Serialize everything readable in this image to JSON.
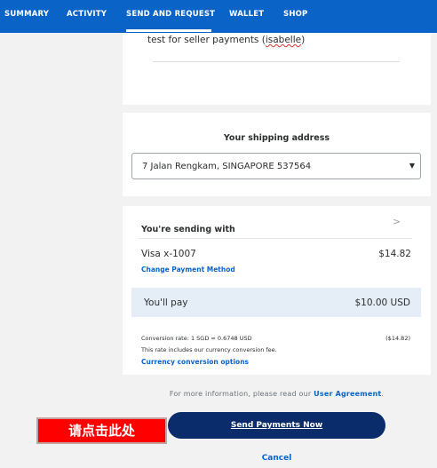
{
  "nav": {
    "items": [
      "SUMMARY",
      "ACTIVITY",
      "SEND AND REQUEST",
      "WALLET",
      "SHOP"
    ],
    "active": "SEND AND REQUEST"
  },
  "note": {
    "text_prefix": "test for seller payments (",
    "text_name": "isabelle",
    "text_suffix": ")"
  },
  "shipping": {
    "title": "Your shipping address",
    "selected_address": "7 Jalan Rengkam, SINGAPORE 537564"
  },
  "sending": {
    "title": "You're sending with",
    "card_name": "Visa  x-1007",
    "card_amount": "$14.82",
    "change_link": "Change Payment Method",
    "pay_label": "You'll pay",
    "pay_amount": "$10.00 USD",
    "conversion_rate": "Conversion rate: 1 SGD = 0.6748 USD",
    "conversion_amount": "($14.82)",
    "conversion_fee_note": "This rate includes our currency conversion fee.",
    "conversion_options_link": "Currency conversion options"
  },
  "agreement": {
    "prefix": "For more information, please read our ",
    "link": "User Agreement",
    "suffix": "."
  },
  "actions": {
    "annotation_label": "请点击此处",
    "send_label": "Send Payments Now",
    "cancel_label": "Cancel"
  },
  "colors": {
    "nav_blue": "#0a64c8",
    "button_navy": "#0a2c6b",
    "link_blue": "#0a64c8",
    "annotation_red": "#ff0000"
  }
}
